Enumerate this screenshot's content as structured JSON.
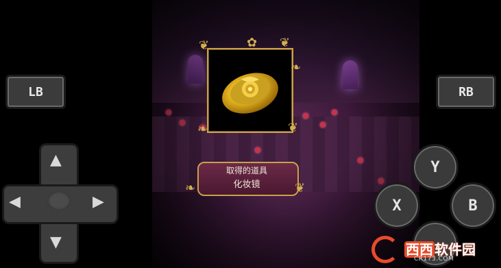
{
  "buttons": {
    "lb_label": "LB",
    "rb_label": "RB",
    "y_label": "Y",
    "x_label": "X",
    "b_label": "B",
    "a_label": ""
  },
  "dpad": {
    "up_icon": "▲",
    "down_icon": "▼",
    "left_icon": "◀",
    "right_icon": "▶"
  },
  "item_popup": {
    "heading": "取得的道具",
    "item_name": "化妆镜",
    "item_icon": "golden-rose-compact-mirror-icon"
  },
  "watermark": {
    "logo_icon": "c-logo-icon",
    "site_red": "西西",
    "site_text": "软件园",
    "url": "CR173.COM"
  },
  "colors": {
    "gold_frame": "#c9a24a",
    "plate": "#6b2a48",
    "button_gray": "#3a3a3a",
    "watermark_accent": "#e84b2a"
  }
}
